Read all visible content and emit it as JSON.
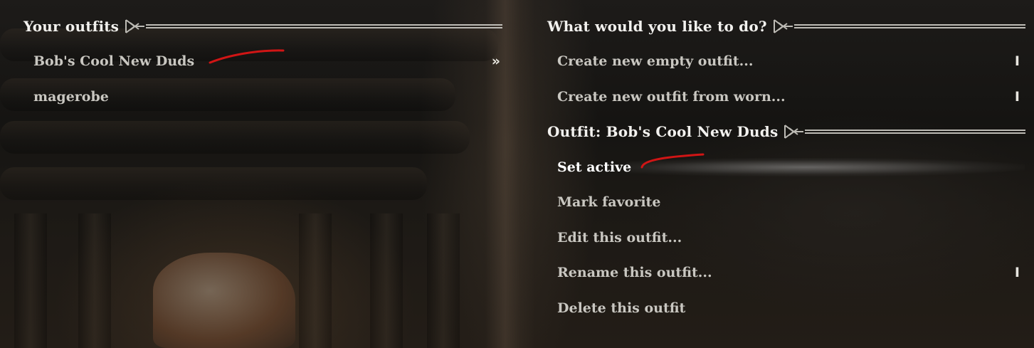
{
  "left_panel": {
    "header": "Your outfits",
    "items": [
      {
        "label": "Bob's Cool New Duds",
        "marker": "»"
      },
      {
        "label": "magerobe"
      }
    ]
  },
  "right_panel": {
    "header": "What would you like to do?",
    "actions": [
      {
        "label": "Create new empty outfit...",
        "marker": "I"
      },
      {
        "label": "Create new outfit from worn...",
        "marker": "I"
      }
    ],
    "outfit_header": "Outfit: Bob's Cool New Duds",
    "outfit_actions": [
      {
        "label": "Set active"
      },
      {
        "label": "Mark favorite"
      },
      {
        "label": "Edit this outfit..."
      },
      {
        "label": "Rename this outfit...",
        "marker": "I"
      },
      {
        "label": "Delete this outfit"
      }
    ]
  },
  "colors": {
    "annotation": "#d01515",
    "text": "#c9c7c1",
    "header_text": "#f2f1ee"
  }
}
